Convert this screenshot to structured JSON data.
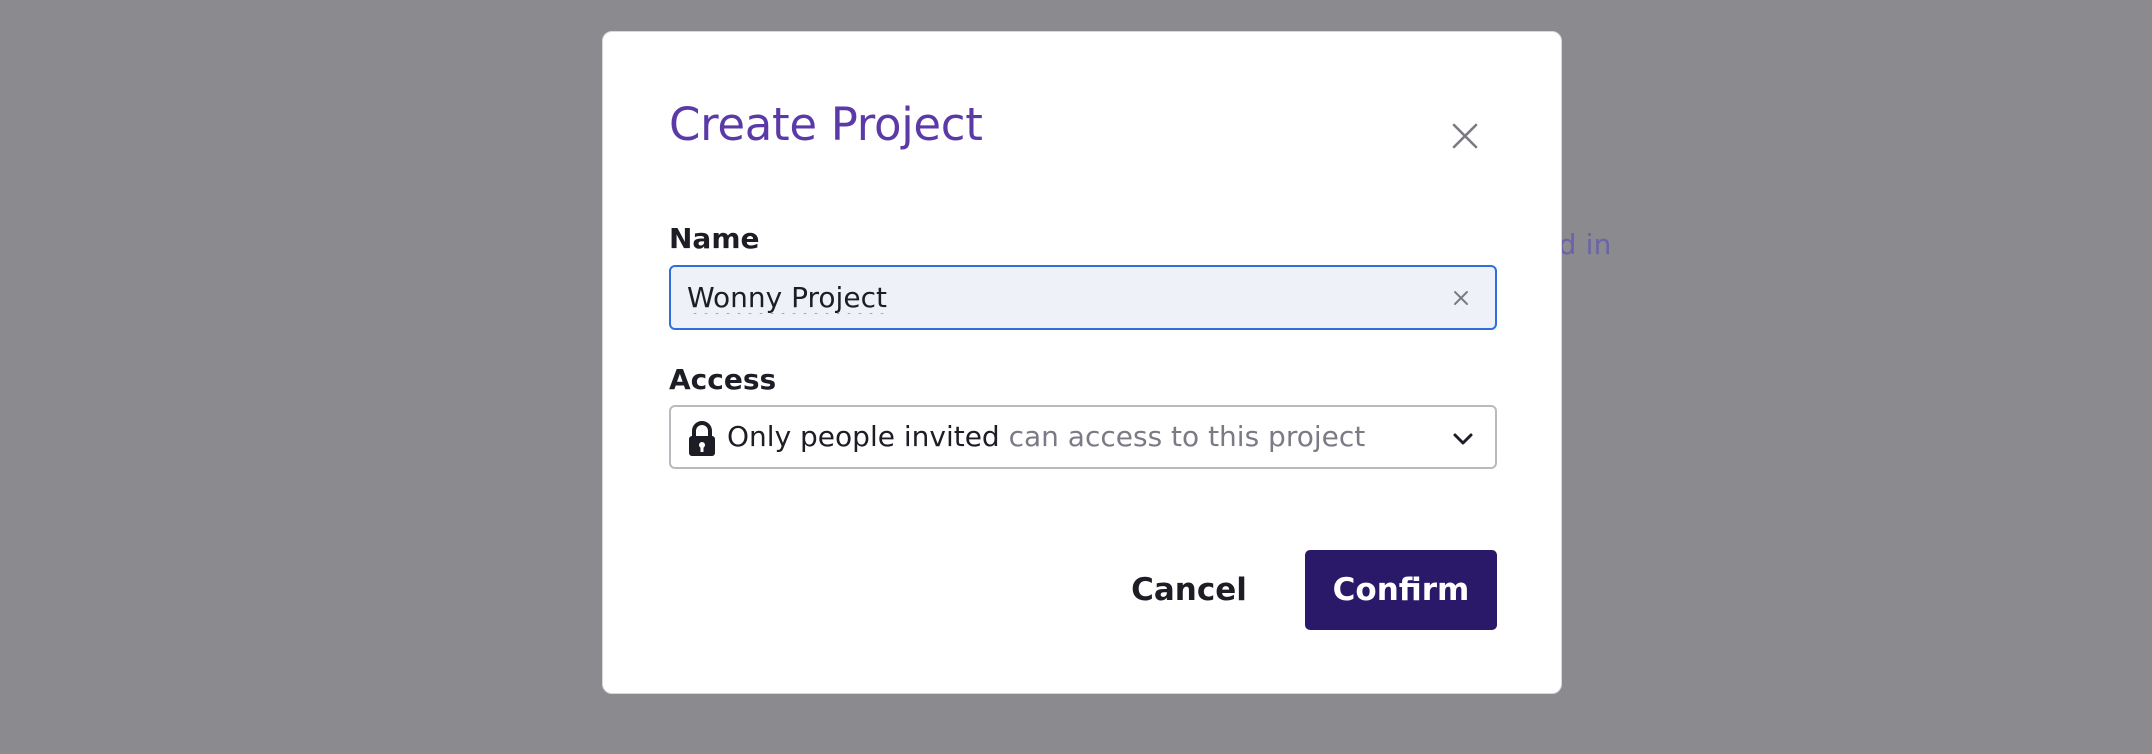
{
  "backdrop": {
    "text": "ted in"
  },
  "dialog": {
    "title": "Create Project",
    "close_icon": "close-icon",
    "name_field": {
      "label": "Name",
      "value": "Wonny Project",
      "clear_icon": "clear-icon"
    },
    "access_field": {
      "label": "Access",
      "icon": "lock-icon",
      "selected_strong": "Only people invited",
      "selected_muted": "can access to this project",
      "chevron_icon": "chevron-down-icon"
    },
    "cancel_label": "Cancel",
    "confirm_label": "Confirm"
  },
  "colors": {
    "backdrop": "#8a8a8f",
    "title": "#5b3aa8",
    "input_focus": "#2f6fdc",
    "input_bg": "#eef2f8",
    "confirm_bg": "#2a1868"
  }
}
